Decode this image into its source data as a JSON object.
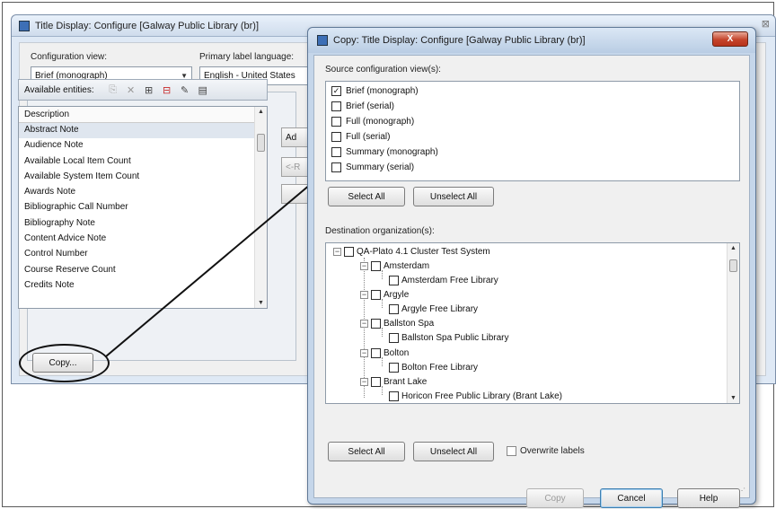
{
  "main_window": {
    "title": "Title Display: Configure [Galway Public Library (br)]",
    "configuration_view_label": "Configuration view:",
    "configuration_view_value": "Brief (monograph)",
    "primary_label_language_label": "Primary label language:",
    "primary_label_language_value": "English - United States",
    "available_entities_label": "Available entities:",
    "toolbar_icons": [
      "copy-icon",
      "delete-icon",
      "add-entity-icon",
      "remove-entity-icon",
      "edit-icon",
      "properties-icon"
    ],
    "entity_list_header": "Description",
    "entities": [
      "Abstract Note",
      "Audience Note",
      "Available Local Item Count",
      "Available System Item Count",
      "Awards Note",
      "Bibliographic Call Number",
      "Bibliography Note",
      "Content Advice Note",
      "Control Number",
      "Course Reserve Count",
      "Credits Note"
    ],
    "add_button_partial": "Ad",
    "remove_button_partial": "<-R",
    "copy_button": "Copy..."
  },
  "dialog": {
    "title": "Copy: Title Display: Configure [Galway Public Library (br)]",
    "close_label": "X",
    "source_label": "Source configuration view(s):",
    "source_views": [
      {
        "label": "Brief (monograph)",
        "checked": true
      },
      {
        "label": "Brief (serial)",
        "checked": false
      },
      {
        "label": "Full (monograph)",
        "checked": false
      },
      {
        "label": "Full (serial)",
        "checked": false
      },
      {
        "label": "Summary (monograph)",
        "checked": false
      },
      {
        "label": "Summary (serial)",
        "checked": false
      }
    ],
    "source_select_all": "Select All",
    "source_unselect_all": "Unselect All",
    "destination_label": "Destination organization(s):",
    "destination_tree": {
      "root": "QA-Plato 4.1 Cluster Test System",
      "groups": [
        {
          "name": "Amsterdam",
          "child": "Amsterdam Free Library"
        },
        {
          "name": "Argyle",
          "child": "Argyle Free Library"
        },
        {
          "name": "Ballston Spa",
          "child": "Ballston Spa Public Library"
        },
        {
          "name": "Bolton",
          "child": "Bolton Free Library"
        },
        {
          "name": "Brant Lake",
          "child": "Horicon Free Public Library (Brant Lake)"
        }
      ]
    },
    "dest_select_all": "Select All",
    "dest_unselect_all": "Unselect All",
    "overwrite_labels": "Overwrite labels",
    "copy_button": "Copy",
    "cancel_button": "Cancel",
    "help_button": "Help"
  }
}
